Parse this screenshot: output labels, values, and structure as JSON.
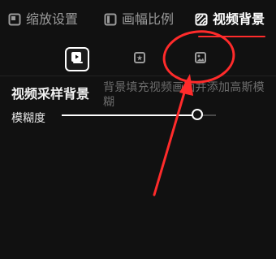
{
  "tabs": [
    {
      "label": "缩放设置",
      "icon": "zoom-settings-icon"
    },
    {
      "label": "画幅比例",
      "icon": "aspect-ratio-icon"
    },
    {
      "label": "视频背景",
      "icon": "video-background-icon"
    }
  ],
  "active_tab_index": 2,
  "background_options": [
    {
      "icon": "video-sample-icon",
      "selected": true
    },
    {
      "icon": "color-icon",
      "selected": false
    },
    {
      "icon": "image-icon",
      "selected": false
    }
  ],
  "section": {
    "title": "视频采样背景",
    "description": "背景填充视频画面并添加高斯模糊"
  },
  "blur": {
    "label": "模糊度",
    "value_fraction": 0.88
  },
  "colors": {
    "accent_red": "#ff2b2b",
    "text": "#ffffff",
    "muted": "#9b9b9b"
  }
}
